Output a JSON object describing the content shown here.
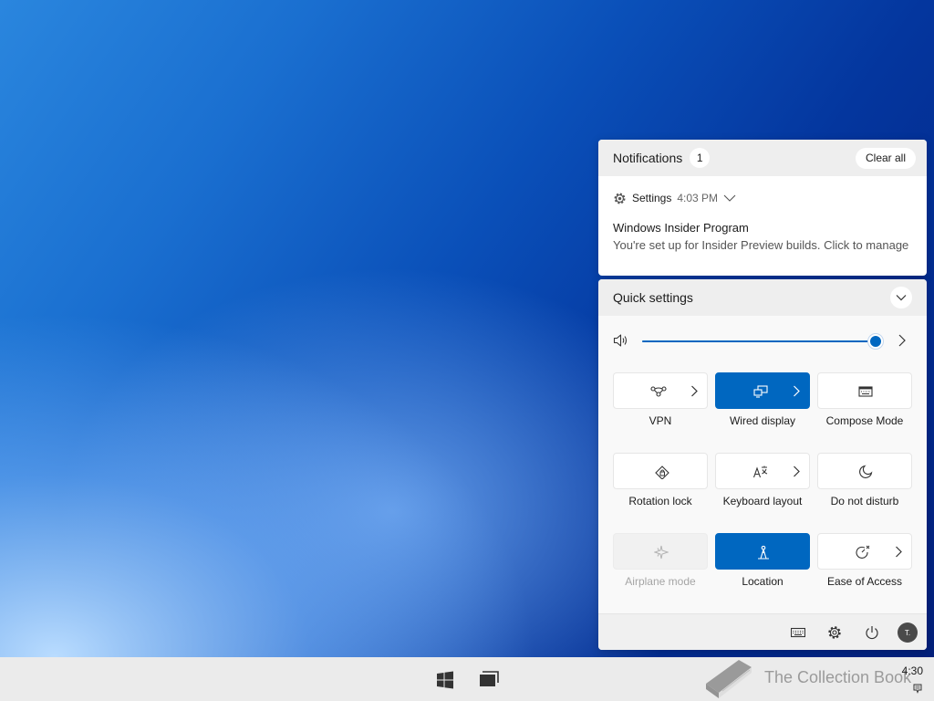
{
  "notifications": {
    "title": "Notifications",
    "count": "1",
    "clear_all_label": "Clear all",
    "item": {
      "app_name": "Settings",
      "app_icon": "gear-icon",
      "time": "4:03 PM",
      "title": "Windows Insider Program",
      "body": "You're set up for Insider Preview builds. Click to manage"
    }
  },
  "quick_settings": {
    "title": "Quick settings",
    "volume": {
      "icon": "speaker-icon",
      "level": 1.0
    },
    "tiles": [
      {
        "label": "VPN",
        "icon": "vpn-icon",
        "state": "off",
        "has_arrow": true
      },
      {
        "label": "Wired display",
        "icon": "wired-display-icon",
        "state": "on",
        "has_arrow": true
      },
      {
        "label": "Compose Mode",
        "icon": "keyboard-icon",
        "state": "off",
        "has_arrow": false
      },
      {
        "label": "Rotation lock",
        "icon": "rotation-lock-icon",
        "state": "off",
        "has_arrow": false
      },
      {
        "label": "Keyboard layout",
        "icon": "keyboard-layout-icon",
        "state": "off",
        "has_arrow": true
      },
      {
        "label": "Do not disturb",
        "icon": "moon-icon",
        "state": "off",
        "has_arrow": false
      },
      {
        "label": "Airplane mode",
        "icon": "airplane-icon",
        "state": "disabled",
        "has_arrow": false
      },
      {
        "label": "Location",
        "icon": "location-icon",
        "state": "on",
        "has_arrow": false
      },
      {
        "label": "Ease of Access",
        "icon": "ease-of-access-icon",
        "state": "off",
        "has_arrow": true
      }
    ],
    "footer": {
      "icons": [
        "keyboard-icon",
        "gear-icon",
        "power-icon"
      ],
      "avatar_initial": "T."
    }
  },
  "taskbar": {
    "clock": "4:30",
    "start_icon": "windows-logo-icon",
    "task_view_icon": "task-view-icon"
  },
  "watermark": {
    "text": "The Collection Book"
  },
  "colors": {
    "accent": "#0067c0",
    "panel": "#f9f9f9",
    "taskbar": "#ebebeb"
  }
}
